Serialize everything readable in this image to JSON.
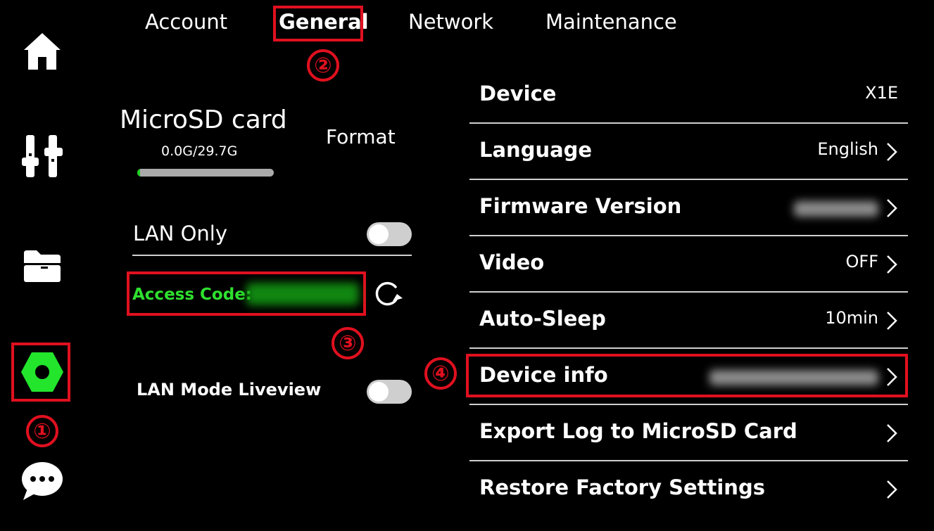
{
  "sidebar": {
    "items": [
      {
        "name": "home",
        "icon": "home-icon"
      },
      {
        "name": "controls",
        "icon": "sliders-icon"
      },
      {
        "name": "files",
        "icon": "folder-icon"
      },
      {
        "name": "settings",
        "icon": "hex-nut-icon",
        "active_color": "#22e52c"
      },
      {
        "name": "messages",
        "icon": "chat-bubble-icon"
      }
    ]
  },
  "tabs": [
    {
      "label": "Account"
    },
    {
      "label": "General"
    },
    {
      "label": "Network"
    },
    {
      "label": "Maintenance"
    }
  ],
  "active_tab": "General",
  "annotations": {
    "one": "①",
    "two": "②",
    "three": "③",
    "four": "④",
    "color": "#e0101f"
  },
  "storage": {
    "title": "MicroSD card",
    "usage": "0.0G/29.7G",
    "used_fraction": 0.02,
    "format_label": "Format"
  },
  "lan": {
    "lan_only_label": "LAN Only",
    "lan_only_on": false,
    "access_code_label": "Access Code:",
    "liveview_label": "LAN Mode Liveview",
    "liveview_on": false
  },
  "settings": {
    "device": {
      "label": "Device",
      "value": "X1E"
    },
    "language": {
      "label": "Language",
      "value": "English"
    },
    "firmware": {
      "label": "Firmware Version"
    },
    "video": {
      "label": "Video",
      "value": "OFF"
    },
    "auto_sleep": {
      "label": "Auto-Sleep",
      "value": "10min"
    },
    "device_info": {
      "label": "Device info"
    },
    "export_log": {
      "label": "Export Log to MicroSD Card"
    },
    "restore": {
      "label": "Restore Factory Settings"
    }
  },
  "colors": {
    "background": "#000000",
    "accent_green": "#22e52c",
    "access_code_green": "#2ee02e",
    "annotation_red": "#e0101f"
  }
}
